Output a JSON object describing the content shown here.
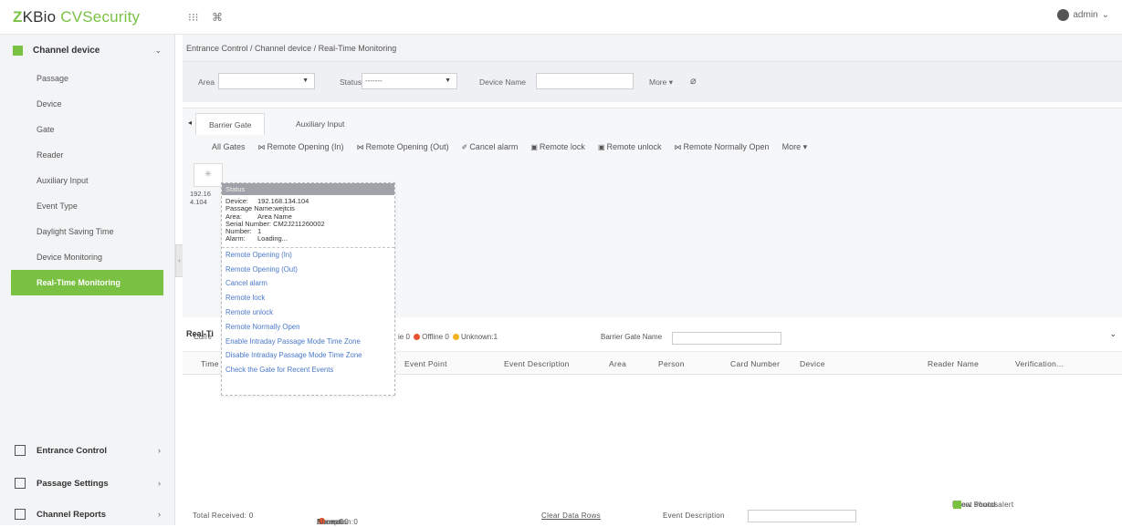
{
  "app": {
    "logo_prefix": "Z",
    "logo_main": "KBio ",
    "logo_suffix": "CVSecurity",
    "user": "admin"
  },
  "top_icons": [
    "grid-icon",
    "command-icon"
  ],
  "sidebar": {
    "module": "Channel device",
    "items": [
      {
        "label": "Passage"
      },
      {
        "label": "Device"
      },
      {
        "label": "Gate"
      },
      {
        "label": "Reader"
      },
      {
        "label": "Auxiliary Input"
      },
      {
        "label": "Event Type"
      },
      {
        "label": "Daylight Saving Time"
      },
      {
        "label": "Device Monitoring"
      },
      {
        "label": "Real-Time Monitoring"
      }
    ],
    "bottom_modules": [
      {
        "label": "Entrance Control"
      },
      {
        "label": "Passage Settings"
      },
      {
        "label": "Channel Reports"
      }
    ]
  },
  "breadcrumb": "Entrance Control / Channel device / Real-Time Monitoring",
  "filters": {
    "area_label": "Area",
    "status_label": "Status",
    "status_value": "-------",
    "device_name_label": "Device Name",
    "more_label": "More"
  },
  "tabs": [
    "Barrier Gate",
    "Auxiliary Input"
  ],
  "toolbar": [
    "All Gates",
    "Remote Opening (In)",
    "Remote Opening (Out)",
    "Cancel alarm",
    "Remote lock",
    "Remote unlock",
    "Remote Normally Open",
    "More"
  ],
  "device": {
    "label_line1": "192.16",
    "label_line2": "4.104"
  },
  "popup": {
    "header": "Status",
    "info": [
      {
        "k": "Device:",
        "v": "192.168.134.104"
      },
      {
        "k": "Passage Name:",
        "v": "wejtcis"
      },
      {
        "k": "Area:",
        "v": "Area Name"
      },
      {
        "k": "Serial Number:",
        "v": "CM2J211260002"
      },
      {
        "k": "Number:",
        "v": "1"
      },
      {
        "k": "Alarm:",
        "v": "Loading..."
      }
    ],
    "actions": [
      "Remote Opening (In)",
      "Remote Opening (Out)",
      "Cancel alarm",
      "Remote lock",
      "Remote unlock",
      "Remote Normally Open",
      "Enable Intraday Passage Mode Time Zone",
      "Disable Intraday Passage Mode Time Zone",
      "Check the Gate for Recent Events"
    ]
  },
  "status_bar": {
    "current_label": "Curre",
    "online_text": "ie 0",
    "offline_text": "Offline 0",
    "unknown_text": "Unknown:1",
    "barrier_gate_name_label": "Barrier Gate Name"
  },
  "realtime": {
    "title": "Real-Ti",
    "columns": [
      "Time",
      "Event Point",
      "Event Description",
      "Area",
      "Person",
      "Card Number",
      "Device",
      "Reader Name",
      "Verification..."
    ]
  },
  "footer": {
    "total": "Total Received: 0",
    "normal": "Normal:0",
    "exception": "Exception:0",
    "alarm": "Alarm:0",
    "clear": "Clear Data Rows",
    "event_description": "Event Description",
    "sound_alert": "Event sound alert",
    "show_photos": "Show Photos"
  },
  "colors": {
    "accent": "#7ac143",
    "link": "#4a79c9",
    "offline": "#e8542f",
    "unknown": "#f0b21f",
    "normal": "#4cae4c"
  }
}
